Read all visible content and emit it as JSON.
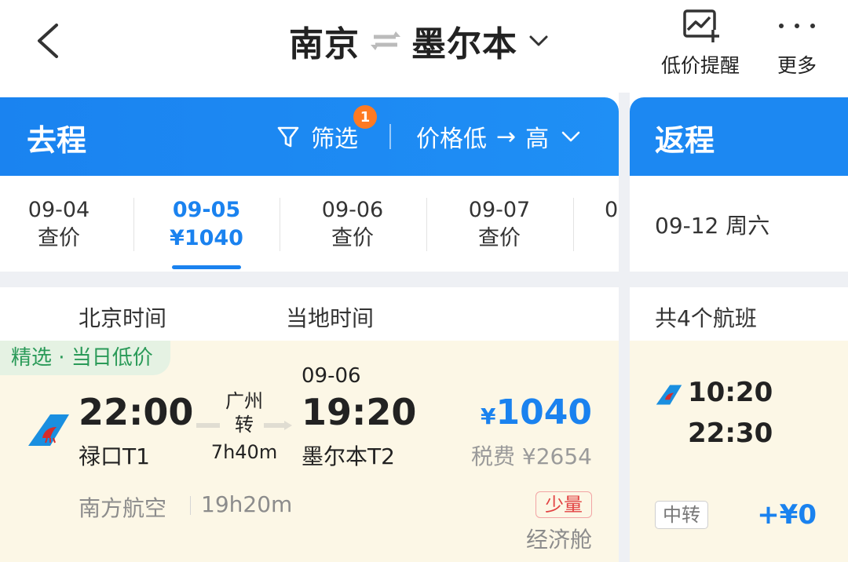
{
  "topbar": {
    "origin": "南京",
    "destination": "墨尔本",
    "low_price_alert_label": "低价提醒",
    "more_label": "更多"
  },
  "outbound": {
    "title": "去程",
    "filter_label": "筛选",
    "filter_count": "1",
    "sort_from": "价格低",
    "sort_arrow": "→",
    "sort_to": "高",
    "dates": [
      {
        "date": "09-04",
        "price": "查价"
      },
      {
        "date": "09-05",
        "price": "¥1040"
      },
      {
        "date": "09-06",
        "price": "查价"
      },
      {
        "date": "09-07",
        "price": "查价"
      },
      {
        "date": "0",
        "price": ""
      }
    ],
    "selected_date_index": 1,
    "timezone_labels": [
      "北京时间",
      "当地时间"
    ],
    "flight": {
      "tag": "精选 · 当日低价",
      "dep_time": "22:00",
      "dep_airport": "禄口T1",
      "via_city": "广州",
      "via_label": "转",
      "layover": "7h40m",
      "arr_date": "09-06",
      "arr_time": "19:20",
      "arr_airport": "墨尔本T2",
      "price_currency": "¥",
      "price": "1040",
      "tax": "税费 ¥2654",
      "airline": "南方航空",
      "duration": "19h20m",
      "availability": "少量",
      "cabin": "经济舱"
    }
  },
  "return": {
    "title": "返程",
    "date": "09-12 周六",
    "count": "共4个航班",
    "flight": {
      "dep_time": "10:20",
      "arr_time": "22:30",
      "transfer": "中转",
      "price": "+¥0"
    }
  },
  "colors": {
    "primary": "#1a82ef",
    "badge": "#ff7a22",
    "card_bg": "#fcf7e6",
    "tag_green": "#2a9a58",
    "scarce_red": "#e24242"
  },
  "icons": {
    "back": "chevron-left-icon",
    "swap": "swap-arrows-icon",
    "route_dropdown": "chevron-down-icon",
    "alert": "price-chart-plus-icon",
    "more": "more-dots-icon",
    "filter": "funnel-icon",
    "sort_dropdown": "chevron-down-icon",
    "airline_logo": "china-southern-logo-icon"
  }
}
